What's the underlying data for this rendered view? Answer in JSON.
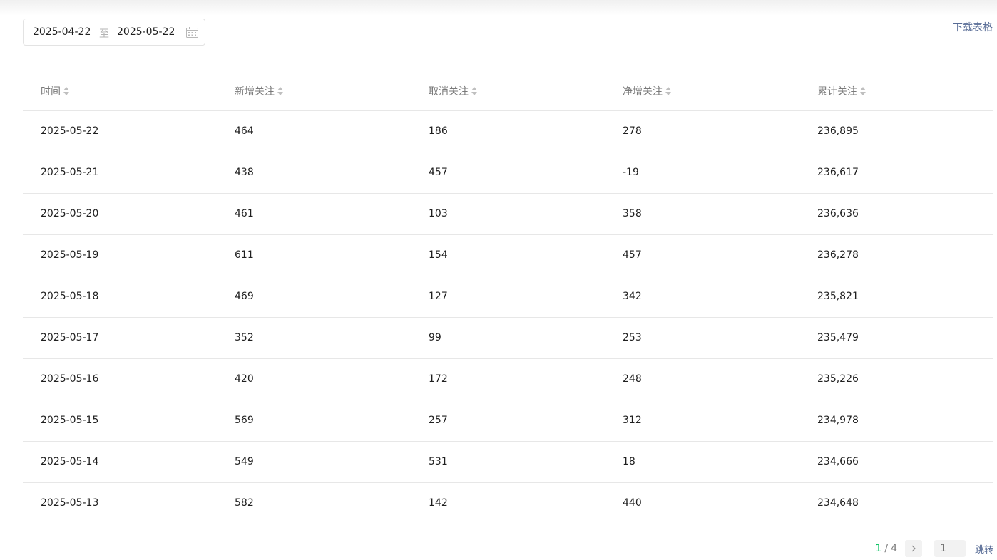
{
  "date_range": {
    "start": "2025-04-22",
    "separator": "至",
    "end": "2025-05-22",
    "icon": "calendar-icon"
  },
  "download_label": "下载表格",
  "table": {
    "headers": [
      "时间",
      "新增关注",
      "取消关注",
      "净增关注",
      "累计关注"
    ],
    "rows": [
      [
        "2025-05-22",
        "464",
        "186",
        "278",
        "236,895"
      ],
      [
        "2025-05-21",
        "438",
        "457",
        "-19",
        "236,617"
      ],
      [
        "2025-05-20",
        "461",
        "103",
        "358",
        "236,636"
      ],
      [
        "2025-05-19",
        "611",
        "154",
        "457",
        "236,278"
      ],
      [
        "2025-05-18",
        "469",
        "127",
        "342",
        "235,821"
      ],
      [
        "2025-05-17",
        "352",
        "99",
        "253",
        "235,479"
      ],
      [
        "2025-05-16",
        "420",
        "172",
        "248",
        "235,226"
      ],
      [
        "2025-05-15",
        "569",
        "257",
        "312",
        "234,978"
      ],
      [
        "2025-05-14",
        "549",
        "531",
        "18",
        "234,666"
      ],
      [
        "2025-05-13",
        "582",
        "142",
        "440",
        "234,648"
      ]
    ]
  },
  "pagination": {
    "current": "1",
    "separator": "/",
    "total": "4",
    "jump_placeholder": "1",
    "jump_label": "跳转"
  },
  "colors": {
    "accent_green": "#07c160",
    "link_blue": "#576b95",
    "header_text": "#7a7a7a",
    "border": "#e7e7e7"
  }
}
